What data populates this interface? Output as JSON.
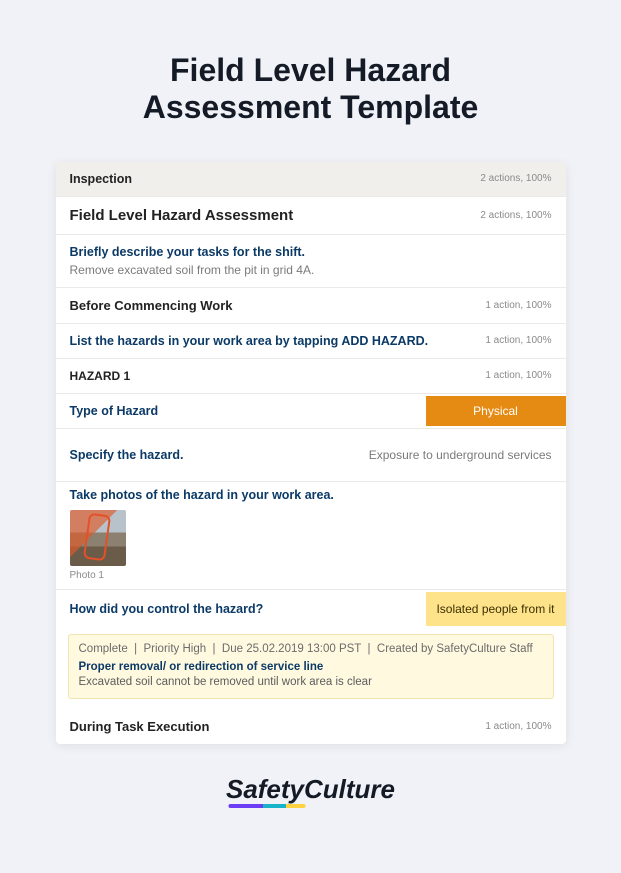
{
  "page_title": "Field Level Hazard Assessment Template",
  "card": {
    "inspection": {
      "label": "Inspection",
      "meta": "2 actions, 100%"
    },
    "assessment": {
      "title": "Field Level Hazard Assessment",
      "meta": "2 actions, 100%"
    },
    "tasks_prompt": "Briefly describe your tasks for the shift.",
    "tasks_value": "Remove excavated soil from the pit in grid 4A.",
    "before": {
      "heading": "Before Commencing Work",
      "meta": "1 action, 100%"
    },
    "list_hazards": {
      "prompt": "List the hazards in your work area by tapping ADD HAZARD.",
      "meta": "1 action, 100%"
    },
    "hazard1": {
      "label": "HAZARD 1",
      "meta": "1 action, 100%"
    },
    "type": {
      "label": "Type of Hazard",
      "value": "Physical"
    },
    "specify": {
      "prompt": "Specify the hazard.",
      "value": "Exposure to underground services"
    },
    "photos": {
      "prompt": "Take photos of the hazard in your work area.",
      "caption": "Photo 1"
    },
    "control": {
      "prompt": "How did you control the hazard?",
      "value": "Isolated people from it"
    },
    "action": {
      "status": "Complete",
      "priority": "Priority High",
      "due": "Due 25.02.2019 13:00 PST",
      "created": "Created by SafetyCulture Staff",
      "title": "Proper removal/ or redirection of service line",
      "subtitle": "Excavated soil cannot be removed until work area is clear"
    },
    "during": {
      "heading": "During Task Execution",
      "meta": "1 action, 100%"
    }
  },
  "brand": "SafetyCulture"
}
